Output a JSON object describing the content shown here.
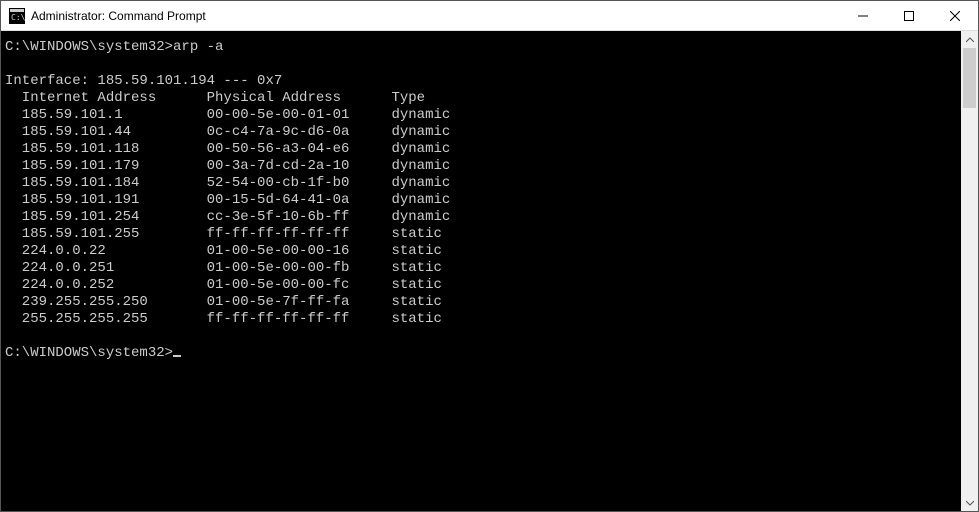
{
  "window": {
    "title": "Administrator: Command Prompt"
  },
  "terminal": {
    "prompt1": "C:\\WINDOWS\\system32>",
    "command": "arp -a",
    "blank1": "",
    "interface_line": "Interface: 185.59.101.194 --- 0x7",
    "headers": {
      "col1": "Internet Address",
      "col2": "Physical Address",
      "col3": "Type"
    },
    "rows": [
      {
        "ip": "185.59.101.1",
        "mac": "00-00-5e-00-01-01",
        "type": "dynamic"
      },
      {
        "ip": "185.59.101.44",
        "mac": "0c-c4-7a-9c-d6-0a",
        "type": "dynamic"
      },
      {
        "ip": "185.59.101.118",
        "mac": "00-50-56-a3-04-e6",
        "type": "dynamic"
      },
      {
        "ip": "185.59.101.179",
        "mac": "00-3a-7d-cd-2a-10",
        "type": "dynamic"
      },
      {
        "ip": "185.59.101.184",
        "mac": "52-54-00-cb-1f-b0",
        "type": "dynamic"
      },
      {
        "ip": "185.59.101.191",
        "mac": "00-15-5d-64-41-0a",
        "type": "dynamic"
      },
      {
        "ip": "185.59.101.254",
        "mac": "cc-3e-5f-10-6b-ff",
        "type": "dynamic"
      },
      {
        "ip": "185.59.101.255",
        "mac": "ff-ff-ff-ff-ff-ff",
        "type": "static"
      },
      {
        "ip": "224.0.0.22",
        "mac": "01-00-5e-00-00-16",
        "type": "static"
      },
      {
        "ip": "224.0.0.251",
        "mac": "01-00-5e-00-00-fb",
        "type": "static"
      },
      {
        "ip": "224.0.0.252",
        "mac": "01-00-5e-00-00-fc",
        "type": "static"
      },
      {
        "ip": "239.255.255.250",
        "mac": "01-00-5e-7f-ff-fa",
        "type": "static"
      },
      {
        "ip": "255.255.255.255",
        "mac": "ff-ff-ff-ff-ff-ff",
        "type": "static"
      }
    ],
    "prompt2": "C:\\WINDOWS\\system32>"
  }
}
